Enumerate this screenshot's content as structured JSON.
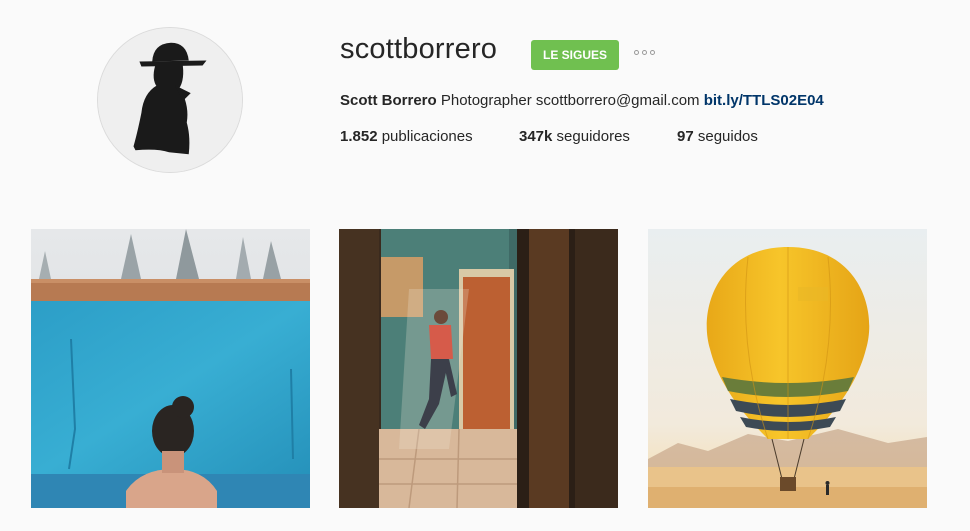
{
  "profile": {
    "username": "scottborrero",
    "follow_button_label": "LE SIGUES",
    "full_name": "Scott Borrero",
    "bio_text": "Photographer scottborrero@gmail.com",
    "bio_link": "bit.ly/TTLS02E04"
  },
  "stats": {
    "posts_count": "1.852",
    "posts_label": "publicaciones",
    "followers_count": "347k",
    "followers_label": "seguidores",
    "following_count": "97",
    "following_label": "seguidos"
  },
  "icons": {
    "more": "more-options-icon"
  },
  "colors": {
    "follow_button": "#70c050",
    "link": "#003569",
    "background": "#fafafa"
  },
  "posts": [
    {
      "alt": "woman-in-blue-pool"
    },
    {
      "alt": "man-climbing-window"
    },
    {
      "alt": "yellow-hot-air-balloon"
    }
  ]
}
